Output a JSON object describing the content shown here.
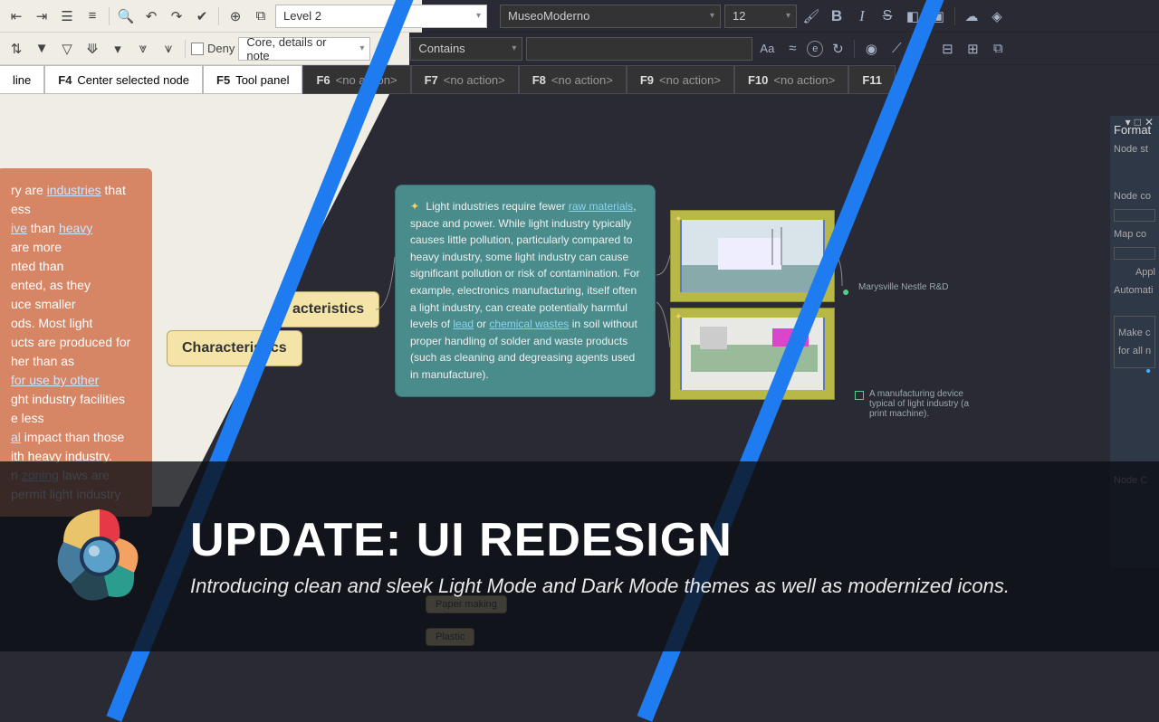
{
  "toolbar": {
    "style_dropdown": "Level 2",
    "font_dropdown": "MuseoModerno",
    "size_dropdown": "12",
    "deny_label": "Deny",
    "filter_placeholder": "Core, details or note",
    "condition_dropdown": "Contains"
  },
  "fkeys": {
    "f3_suffix": "line",
    "f4": "F4",
    "f4_label": "Center selected node",
    "f5": "F5",
    "f5_label": "Tool panel",
    "f6": "F6",
    "f7": "F7",
    "f8": "F8",
    "f9": "F9",
    "f10": "F10",
    "f11": "F11",
    "noaction": "<no action>"
  },
  "map": {
    "characteristics": "Characteristics",
    "characteristics_clip": "acteristics",
    "orange_text_pre": "ry are ",
    "orange_link1": "industries",
    "orange_text_1": " that",
    "orange_text_2": "ess",
    "orange_link2": "ive",
    "orange_text_3": " than ",
    "orange_link3": "heavy",
    "orange_block": "are more\nnted than\nented, as they\nuce smaller\nods. Most light\nucts are produced for\nher than as",
    "orange_link4": "for use by other",
    "orange_text_4": "ght industry facilities\ne less",
    "orange_link5": "al",
    "orange_text_5": " impact than those\nith heavy industry.\nn ",
    "orange_link6": "zoning",
    "orange_text_6": " laws are\npermit light industry",
    "teal_pre": "Light industries require fewer ",
    "teal_link1": "raw materials",
    "teal_mid1": ", space and power. While light industry typically causes little pollution, particularly compared to heavy industry, some light industry can cause significant pollution or risk of contamination. For example, electronics manufacturing, itself often a light industry, can create potentially harmful levels of ",
    "teal_link2": "lead",
    "teal_mid2": " or ",
    "teal_link3": "chemical wastes",
    "teal_end": " in soil without proper handling of solder and waste products (such as cleaning and degreasing agents used in manufacture).",
    "caption1": "Marysville Nestle R&D",
    "caption2": "A manufacturing device typical of light industry (a print machine).",
    "tag1": "Paper making",
    "tag2": "Plastic"
  },
  "panel": {
    "title": "Format",
    "node_style": "Node st",
    "node_color": "Node co",
    "map_color": "Map co",
    "apply": "Appl",
    "auto": "Automati",
    "check_label": "Make cu",
    "check_sub": "for all no",
    "node_c2": "Node C"
  },
  "banner": {
    "title": "UPDATE: UI REDESIGN",
    "subtitle": "Introducing clean and sleek Light Mode and Dark Mode themes as well as modernized icons."
  }
}
